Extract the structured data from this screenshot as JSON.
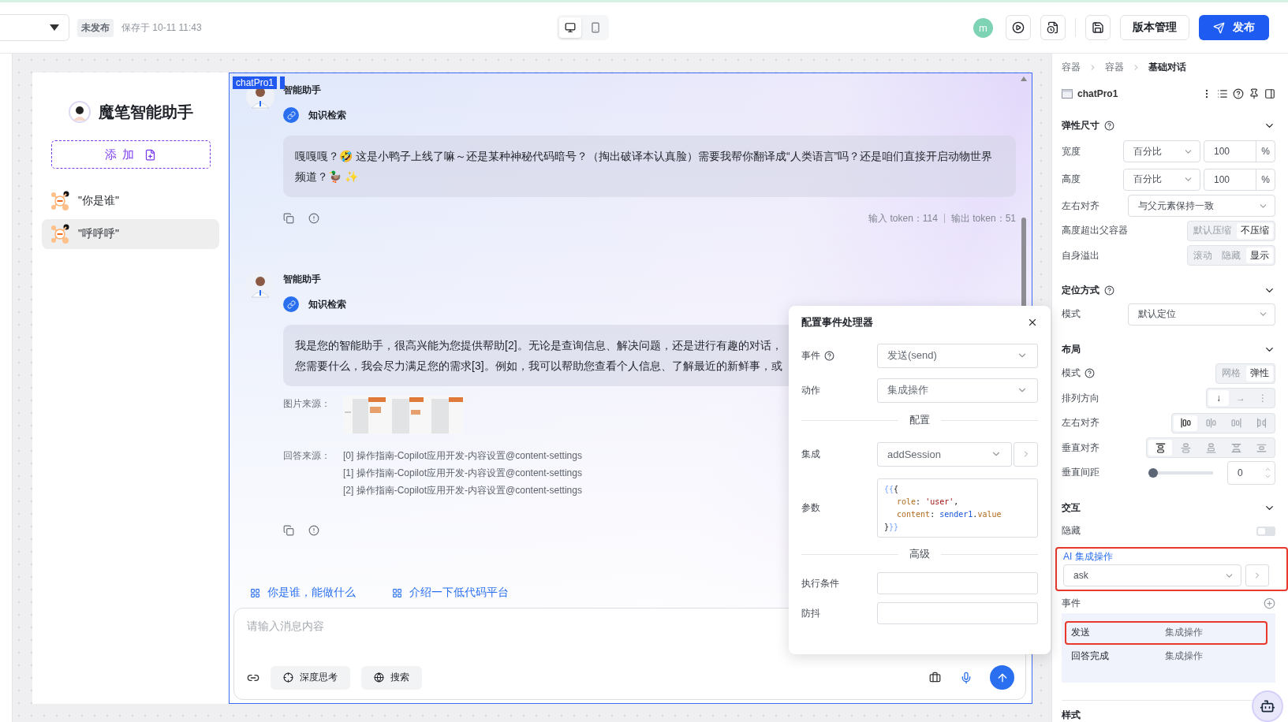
{
  "topbar": {
    "status_badge": "未发布",
    "saved_at": "保存于 10-11 11:43",
    "devices": [
      {
        "kind": "desktop",
        "selected": true
      },
      {
        "kind": "mobile",
        "selected": false
      }
    ],
    "user_initial": "m",
    "tools": [
      {
        "kind": "play"
      },
      {
        "kind": "preview"
      },
      {
        "kind": "save"
      }
    ],
    "version_button": "版本管理",
    "publish_button": "发布"
  },
  "app": {
    "title": "魔笔智能助手",
    "add_button": "添 加",
    "sessions": [
      {
        "label": "\"你是谁\"",
        "selected": false
      },
      {
        "label": "\"呼呼呼\"",
        "selected": true
      }
    ]
  },
  "chat": {
    "tag": "chatPro1",
    "messages": [
      {
        "sender": "智能助手",
        "tool": "知识检索",
        "paragraphs": [
          "嘎嘎嘎？🤣 这是小鸭子上线了嘛～还是某种神秘代码暗号？（掏出破译本认真脸）需要我帮你翻译成“人类语言”吗？还是咱们直接开启动物世界",
          "频道？🦆 ✨"
        ],
        "token_in": "输入 token：114",
        "token_out": "输出 token：51"
      },
      {
        "sender": "智能助手",
        "tool": "知识检索",
        "paragraphs": [
          "我是您的智能助手，很高兴能为您提供帮助[2]。无论是查询信息、解决问题，还是进行有趣的对话，",
          "您需要什么，我会尽力满足您的需求[3]。例如，我可以帮助您查看个人信息、了解最近的新鲜事，或"
        ],
        "images_label": "图片来源：",
        "sources_label": "回答来源：",
        "sources": [
          "[0] 操作指南-Copilot应用开发-内容设置@content-settings",
          "[1] 操作指南-Copilot应用开发-内容设置@content-settings",
          "[2] 操作指南-Copilot应用开发-内容设置@content-settings"
        ]
      }
    ],
    "suggestions": [
      "你是谁，能做什么",
      "介绍一下低代码平台"
    ],
    "input": {
      "placeholder": "请输入消息内容",
      "tools": [
        {
          "kind": "think",
          "label": "深度思考"
        },
        {
          "kind": "search",
          "label": "搜索"
        }
      ]
    }
  },
  "popover": {
    "title": "配置事件处理器",
    "fields": [
      {
        "kind": "select",
        "label": "事件",
        "help": true,
        "value": "发送(send)"
      },
      {
        "kind": "select",
        "label": "动作",
        "value": "集成操作"
      },
      {
        "kind": "divider",
        "label": "配置"
      },
      {
        "kind": "select_link",
        "label": "集成",
        "value": "addSession"
      },
      {
        "kind": "code",
        "label": "参数",
        "lines": [
          {
            "nested": false,
            "tokens": [
              {
                "kind": "template",
                "text": "{{"
              },
              {
                "kind": "punct",
                "text": "{"
              }
            ]
          },
          {
            "nested": true,
            "tokens": [
              {
                "kind": "key",
                "text": "role"
              },
              {
                "kind": "punct",
                "text": ": "
              },
              {
                "kind": "string",
                "text": "'user'"
              },
              {
                "kind": "punct",
                "text": ","
              }
            ]
          },
          {
            "nested": true,
            "tokens": [
              {
                "kind": "key",
                "text": "content"
              },
              {
                "kind": "punct",
                "text": ": "
              },
              {
                "kind": "var",
                "text": "sender1"
              },
              {
                "kind": "punct",
                "text": "."
              },
              {
                "kind": "key",
                "text": "value"
              }
            ]
          },
          {
            "nested": false,
            "tokens": [
              {
                "kind": "punct",
                "text": "}"
              },
              {
                "kind": "template",
                "text": "}}"
              }
            ]
          }
        ]
      },
      {
        "kind": "divider",
        "label": "高级"
      },
      {
        "kind": "input",
        "label": "执行条件"
      },
      {
        "kind": "input",
        "label": "防抖"
      }
    ]
  },
  "inspector": {
    "breadcrumb": [
      {
        "label": "容器",
        "current": false
      },
      {
        "label": "容器",
        "current": false
      },
      {
        "label": "基础对话",
        "current": true
      }
    ],
    "component": "chatPro1",
    "sections": [
      {
        "title": "弹性尺寸",
        "help": true,
        "expanded": true,
        "rows": [
          {
            "kind": "select_number",
            "label": "宽度",
            "select": "百分比",
            "number": "100",
            "unit": "%"
          },
          {
            "kind": "select_number",
            "label": "高度",
            "select": "百分比",
            "number": "100",
            "unit": "%"
          },
          {
            "kind": "select",
            "label": "左右对齐",
            "value": "与父元素保持一致"
          },
          {
            "kind": "segmented",
            "label": "高度超出父容器",
            "options": [
              {
                "label": "默认压缩",
                "selected": false
              },
              {
                "label": "不压缩",
                "selected": true
              }
            ]
          },
          {
            "kind": "segmented",
            "label": "自身溢出",
            "options": [
              {
                "label": "滚动",
                "selected": false
              },
              {
                "label": "隐藏",
                "selected": false
              },
              {
                "label": "显示",
                "selected": true
              }
            ]
          }
        ]
      },
      {
        "title": "定位方式",
        "help": true,
        "expanded": true,
        "rows": [
          {
            "kind": "select",
            "label": "模式",
            "value": "默认定位"
          }
        ]
      },
      {
        "title": "布局",
        "expanded": true,
        "rows": [
          {
            "kind": "segmented",
            "label": "模式",
            "help": true,
            "options": [
              {
                "label": "网格",
                "selected": false
              },
              {
                "label": "弹性",
                "selected": true
              }
            ]
          },
          {
            "kind": "segmented",
            "label": "排列方向",
            "options": [
              {
                "label": "↓",
                "selected": true
              },
              {
                "label": "→",
                "selected": false
              },
              {
                "label": "⋮",
                "selected": false
              }
            ]
          },
          {
            "kind": "icon_segmented",
            "label": "左右对齐",
            "options": [
              {
                "kind": "h_start",
                "selected": true
              },
              {
                "kind": "h_center",
                "selected": false
              },
              {
                "kind": "h_end",
                "selected": false
              },
              {
                "kind": "h_between",
                "selected": false
              }
            ]
          },
          {
            "kind": "icon_segmented",
            "label": "垂直对齐",
            "options": [
              {
                "kind": "v_start",
                "selected": true
              },
              {
                "kind": "v_center",
                "selected": false
              },
              {
                "kind": "v_end",
                "selected": false
              },
              {
                "kind": "v_between",
                "selected": false
              },
              {
                "kind": "v_around",
                "selected": false
              }
            ]
          },
          {
            "kind": "slider",
            "label": "垂直间距",
            "level": 0,
            "value": "0"
          }
        ]
      },
      {
        "title": "交互",
        "expanded": true,
        "rows": [
          {
            "kind": "toggle",
            "label": "隐藏",
            "on": false
          }
        ]
      }
    ],
    "ai_action": {
      "label": "AI 集成操作",
      "value": "ask",
      "highlighted": true
    },
    "events": {
      "label": "事件",
      "items": [
        {
          "name": "发送",
          "action": "集成操作",
          "highlighted": true
        },
        {
          "name": "回答完成",
          "action": "集成操作",
          "highlighted": false
        }
      ]
    },
    "style_section": "样式"
  }
}
